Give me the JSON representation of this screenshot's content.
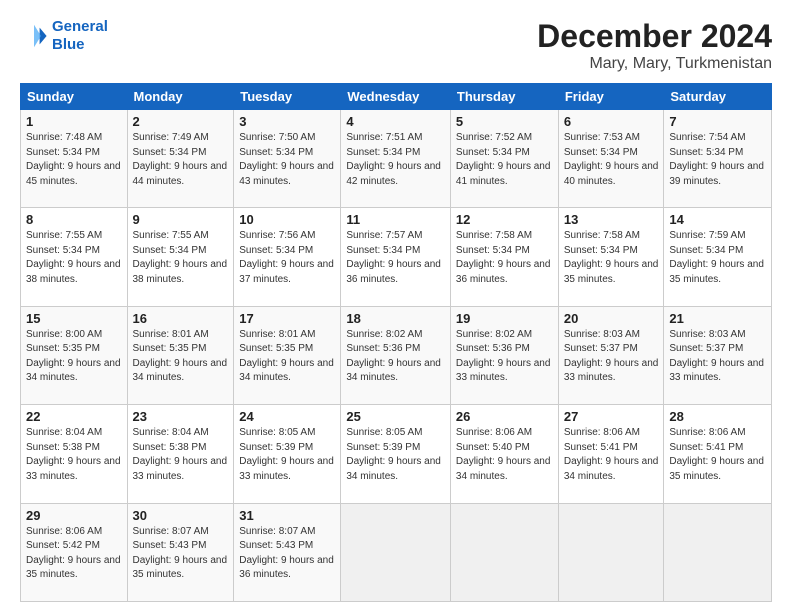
{
  "logo": {
    "line1": "General",
    "line2": "Blue"
  },
  "title": "December 2024",
  "subtitle": "Mary, Mary, Turkmenistan",
  "headers": [
    "Sunday",
    "Monday",
    "Tuesday",
    "Wednesday",
    "Thursday",
    "Friday",
    "Saturday"
  ],
  "weeks": [
    [
      {
        "day": "1",
        "sunrise": "7:48 AM",
        "sunset": "5:34 PM",
        "daylight": "9 hours and 45 minutes."
      },
      {
        "day": "2",
        "sunrise": "7:49 AM",
        "sunset": "5:34 PM",
        "daylight": "9 hours and 44 minutes."
      },
      {
        "day": "3",
        "sunrise": "7:50 AM",
        "sunset": "5:34 PM",
        "daylight": "9 hours and 43 minutes."
      },
      {
        "day": "4",
        "sunrise": "7:51 AM",
        "sunset": "5:34 PM",
        "daylight": "9 hours and 42 minutes."
      },
      {
        "day": "5",
        "sunrise": "7:52 AM",
        "sunset": "5:34 PM",
        "daylight": "9 hours and 41 minutes."
      },
      {
        "day": "6",
        "sunrise": "7:53 AM",
        "sunset": "5:34 PM",
        "daylight": "9 hours and 40 minutes."
      },
      {
        "day": "7",
        "sunrise": "7:54 AM",
        "sunset": "5:34 PM",
        "daylight": "9 hours and 39 minutes."
      }
    ],
    [
      {
        "day": "8",
        "sunrise": "7:55 AM",
        "sunset": "5:34 PM",
        "daylight": "9 hours and 38 minutes."
      },
      {
        "day": "9",
        "sunrise": "7:55 AM",
        "sunset": "5:34 PM",
        "daylight": "9 hours and 38 minutes."
      },
      {
        "day": "10",
        "sunrise": "7:56 AM",
        "sunset": "5:34 PM",
        "daylight": "9 hours and 37 minutes."
      },
      {
        "day": "11",
        "sunrise": "7:57 AM",
        "sunset": "5:34 PM",
        "daylight": "9 hours and 36 minutes."
      },
      {
        "day": "12",
        "sunrise": "7:58 AM",
        "sunset": "5:34 PM",
        "daylight": "9 hours and 36 minutes."
      },
      {
        "day": "13",
        "sunrise": "7:58 AM",
        "sunset": "5:34 PM",
        "daylight": "9 hours and 35 minutes."
      },
      {
        "day": "14",
        "sunrise": "7:59 AM",
        "sunset": "5:34 PM",
        "daylight": "9 hours and 35 minutes."
      }
    ],
    [
      {
        "day": "15",
        "sunrise": "8:00 AM",
        "sunset": "5:35 PM",
        "daylight": "9 hours and 34 minutes."
      },
      {
        "day": "16",
        "sunrise": "8:01 AM",
        "sunset": "5:35 PM",
        "daylight": "9 hours and 34 minutes."
      },
      {
        "day": "17",
        "sunrise": "8:01 AM",
        "sunset": "5:35 PM",
        "daylight": "9 hours and 34 minutes."
      },
      {
        "day": "18",
        "sunrise": "8:02 AM",
        "sunset": "5:36 PM",
        "daylight": "9 hours and 34 minutes."
      },
      {
        "day": "19",
        "sunrise": "8:02 AM",
        "sunset": "5:36 PM",
        "daylight": "9 hours and 33 minutes."
      },
      {
        "day": "20",
        "sunrise": "8:03 AM",
        "sunset": "5:37 PM",
        "daylight": "9 hours and 33 minutes."
      },
      {
        "day": "21",
        "sunrise": "8:03 AM",
        "sunset": "5:37 PM",
        "daylight": "9 hours and 33 minutes."
      }
    ],
    [
      {
        "day": "22",
        "sunrise": "8:04 AM",
        "sunset": "5:38 PM",
        "daylight": "9 hours and 33 minutes."
      },
      {
        "day": "23",
        "sunrise": "8:04 AM",
        "sunset": "5:38 PM",
        "daylight": "9 hours and 33 minutes."
      },
      {
        "day": "24",
        "sunrise": "8:05 AM",
        "sunset": "5:39 PM",
        "daylight": "9 hours and 33 minutes."
      },
      {
        "day": "25",
        "sunrise": "8:05 AM",
        "sunset": "5:39 PM",
        "daylight": "9 hours and 34 minutes."
      },
      {
        "day": "26",
        "sunrise": "8:06 AM",
        "sunset": "5:40 PM",
        "daylight": "9 hours and 34 minutes."
      },
      {
        "day": "27",
        "sunrise": "8:06 AM",
        "sunset": "5:41 PM",
        "daylight": "9 hours and 34 minutes."
      },
      {
        "day": "28",
        "sunrise": "8:06 AM",
        "sunset": "5:41 PM",
        "daylight": "9 hours and 35 minutes."
      }
    ],
    [
      {
        "day": "29",
        "sunrise": "8:06 AM",
        "sunset": "5:42 PM",
        "daylight": "9 hours and 35 minutes."
      },
      {
        "day": "30",
        "sunrise": "8:07 AM",
        "sunset": "5:43 PM",
        "daylight": "9 hours and 35 minutes."
      },
      {
        "day": "31",
        "sunrise": "8:07 AM",
        "sunset": "5:43 PM",
        "daylight": "9 hours and 36 minutes."
      },
      null,
      null,
      null,
      null
    ]
  ],
  "labels": {
    "sunrise": "Sunrise:",
    "sunset": "Sunset:",
    "daylight": "Daylight:"
  }
}
